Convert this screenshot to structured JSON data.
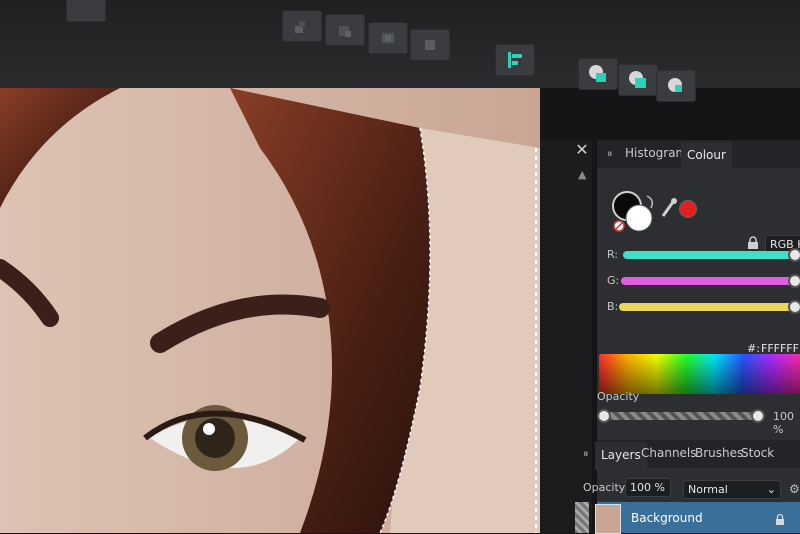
{
  "canvas": {
    "close_symbol": "✕",
    "scroll_up_symbol": "▲"
  },
  "toolbar": {
    "buttons": [
      {
        "name": "align-bottom-left-icon"
      },
      {
        "name": "align-bottom-right-icon"
      },
      {
        "name": "align-center-icon"
      },
      {
        "name": "align-fill-icon"
      },
      {
        "name": "align-left-icon"
      },
      {
        "name": "boolean-add-icon"
      },
      {
        "name": "boolean-subtract-icon"
      },
      {
        "name": "boolean-intersect-icon"
      }
    ]
  },
  "colour_panel": {
    "tabs": [
      "Histogram",
      "Colour"
    ],
    "active_tab": "Colour",
    "mode": "RGB He",
    "r_label": "R:",
    "g_label": "G:",
    "b_label": "B:",
    "r_value": 1.0,
    "g_value": 1.0,
    "b_value": 1.0,
    "hex_label": "#:",
    "hex_value": "FFFFFF",
    "opacity_label": "Opacity",
    "opacity_value": "100 %",
    "colors": {
      "r": "#3fe0c8",
      "g": "#e05fe0",
      "b": "#e8d65a",
      "picker_dot": "#e02020"
    }
  },
  "layers_panel": {
    "tabs": [
      "Layers",
      "Channels",
      "Brushes",
      "Stock"
    ],
    "active_tab": "Layers",
    "opacity_label": "Opacity:",
    "opacity_value": "100 %",
    "blend_mode": "Normal",
    "layer_name": "Background"
  }
}
